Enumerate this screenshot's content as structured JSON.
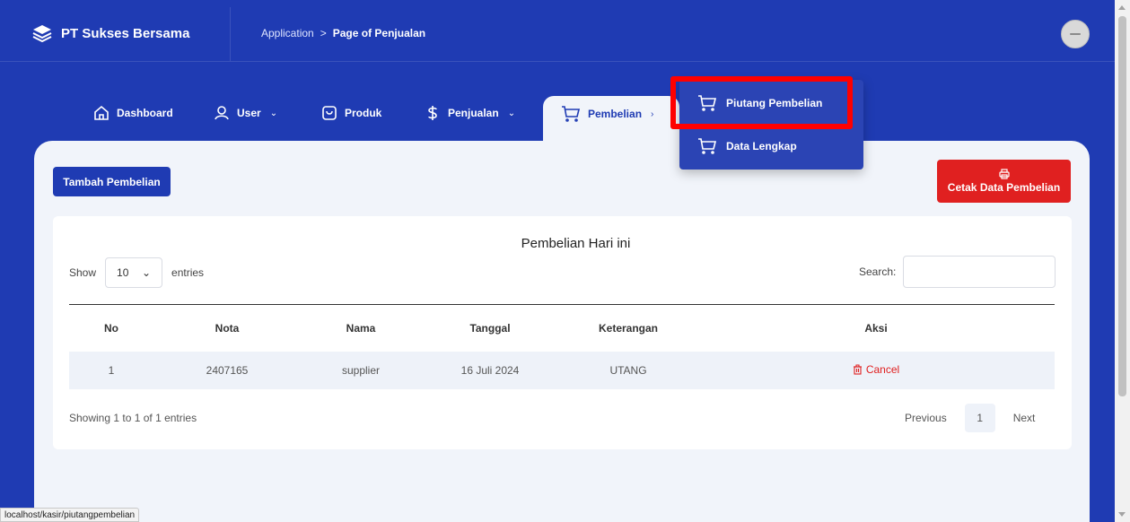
{
  "brand": {
    "name": "PT Sukses Bersama",
    "icon": "layers-icon"
  },
  "breadcrumb": {
    "parent": "Application",
    "separator": ">",
    "current": "Page of Penjualan"
  },
  "nav": {
    "items": [
      {
        "label": "Dashboard",
        "icon": "home-icon",
        "chevron": ""
      },
      {
        "label": "User",
        "icon": "user-icon",
        "chevron": "⌄"
      },
      {
        "label": "Produk",
        "icon": "bag-icon",
        "chevron": ""
      },
      {
        "label": "Penjualan",
        "icon": "dollar-icon",
        "chevron": "⌄"
      },
      {
        "label": "Pembelian",
        "icon": "cart-icon",
        "chevron": "›"
      }
    ],
    "active": "Pembelian"
  },
  "dropdown": {
    "items": [
      {
        "label": "Piutang Pembelian",
        "icon": "cart-icon"
      },
      {
        "label": "Data Lengkap",
        "icon": "cart-icon"
      }
    ],
    "highlighted": "Piutang Pembelian",
    "highlight_color": "#ff0000"
  },
  "actions": {
    "add_label": "Tambah Pembelian",
    "print_label": "Cetak Data Pembelian",
    "print_icon": "printer-icon"
  },
  "table_card": {
    "title": "Pembelian Hari ini",
    "length": {
      "show": "Show",
      "value": "10",
      "entries": "entries"
    },
    "search_label": "Search:",
    "search_value": "",
    "columns": [
      "No",
      "Nota",
      "Nama",
      "Tanggal",
      "Keterangan",
      "Aksi"
    ],
    "rows": [
      {
        "no": "1",
        "nota": "2407165",
        "nama": "supplier",
        "tanggal": "16 Juli 2024",
        "keterangan": "UTANG",
        "aksi": "Cancel"
      }
    ],
    "info": "Showing 1 to 1 of 1 entries",
    "pagination": {
      "previous": "Previous",
      "page": "1",
      "next": "Next"
    }
  },
  "status_bar": "localhost/kasir/piutangpembelian",
  "colors": {
    "primary": "#1f3bb3",
    "danger": "#e02020",
    "panel": "#f1f4fa"
  }
}
